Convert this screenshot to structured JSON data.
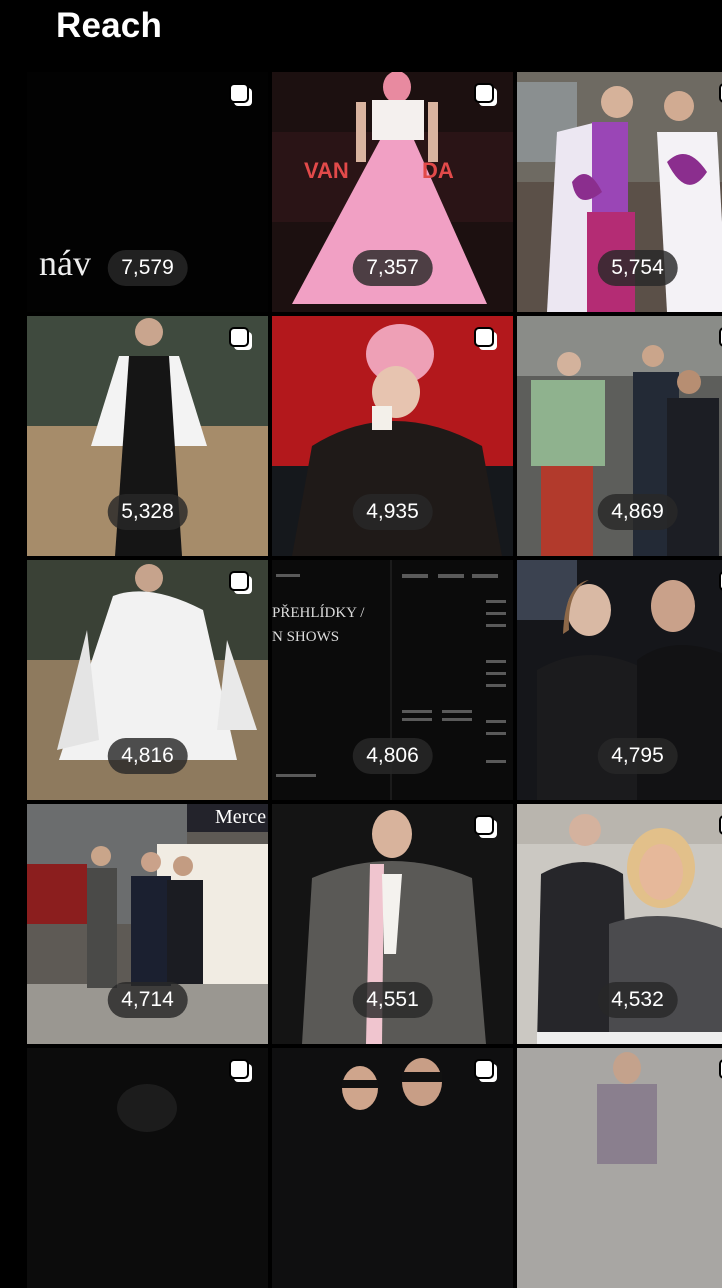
{
  "header": {
    "title": "Reach"
  },
  "posts": [
    {
      "reach": "7,579",
      "overlay_text": "náv"
    },
    {
      "reach": "7,357",
      "overlay_text": "VAN"
    },
    {
      "reach": "5,754"
    },
    {
      "reach": "5,328"
    },
    {
      "reach": "4,935"
    },
    {
      "reach": "4,869"
    },
    {
      "reach": "4,816"
    },
    {
      "reach": "4,806",
      "overlay_lines": [
        "PŘEHLÍDKY /",
        "N SHOWS"
      ]
    },
    {
      "reach": "4,795"
    },
    {
      "reach": "4,714",
      "overlay_text": "Merce"
    },
    {
      "reach": "4,551"
    },
    {
      "reach": "4,532"
    },
    {
      "reach": ""
    },
    {
      "reach": ""
    },
    {
      "reach": ""
    }
  ],
  "icons": {
    "carousel": "multi-photo-icon"
  }
}
